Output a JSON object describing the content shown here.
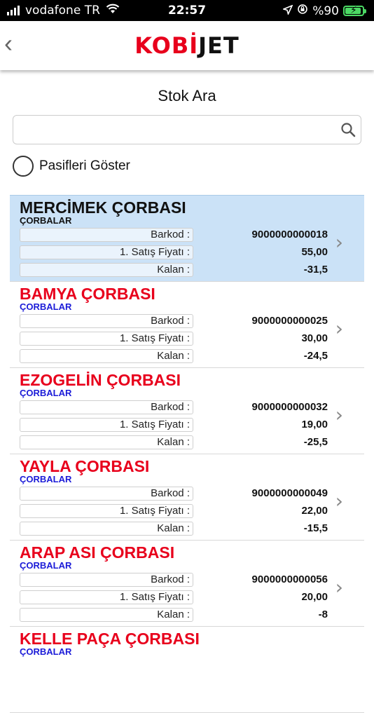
{
  "status": {
    "carrier": "vodafone TR",
    "time": "22:57",
    "battery": "%90",
    "battery_level": 0.9
  },
  "nav": {
    "logo_part1": "KOBİ",
    "logo_part2": "JET"
  },
  "page": {
    "title": "Stok Ara"
  },
  "search": {
    "value": "",
    "placeholder": ""
  },
  "filter": {
    "label": "Pasifleri Göster",
    "checked": false
  },
  "labels": {
    "barcode": "Barkod :",
    "price": "1. Satış Fiyatı :",
    "remaining": "Kalan :"
  },
  "items": [
    {
      "name": "MERCİMEK ÇORBASI",
      "category": "ÇORBALAR",
      "barcode": "9000000000018",
      "price": "55,00",
      "remaining": "-31,5"
    },
    {
      "name": "BAMYA ÇORBASI",
      "category": "ÇORBALAR",
      "barcode": "9000000000025",
      "price": "30,00",
      "remaining": "-24,5"
    },
    {
      "name": "EZOGELİN ÇORBASI",
      "category": "ÇORBALAR",
      "barcode": "9000000000032",
      "price": "19,00",
      "remaining": "-25,5"
    },
    {
      "name": "YAYLA ÇORBASI",
      "category": "ÇORBALAR",
      "barcode": "9000000000049",
      "price": "22,00",
      "remaining": "-15,5"
    },
    {
      "name": "ARAP ASI ÇORBASI",
      "category": "ÇORBALAR",
      "barcode": "9000000000056",
      "price": "20,00",
      "remaining": "-8"
    },
    {
      "name": "KELLE PAÇA ÇORBASI",
      "category": "ÇORBALAR",
      "barcode": "",
      "price": "",
      "remaining": ""
    }
  ]
}
